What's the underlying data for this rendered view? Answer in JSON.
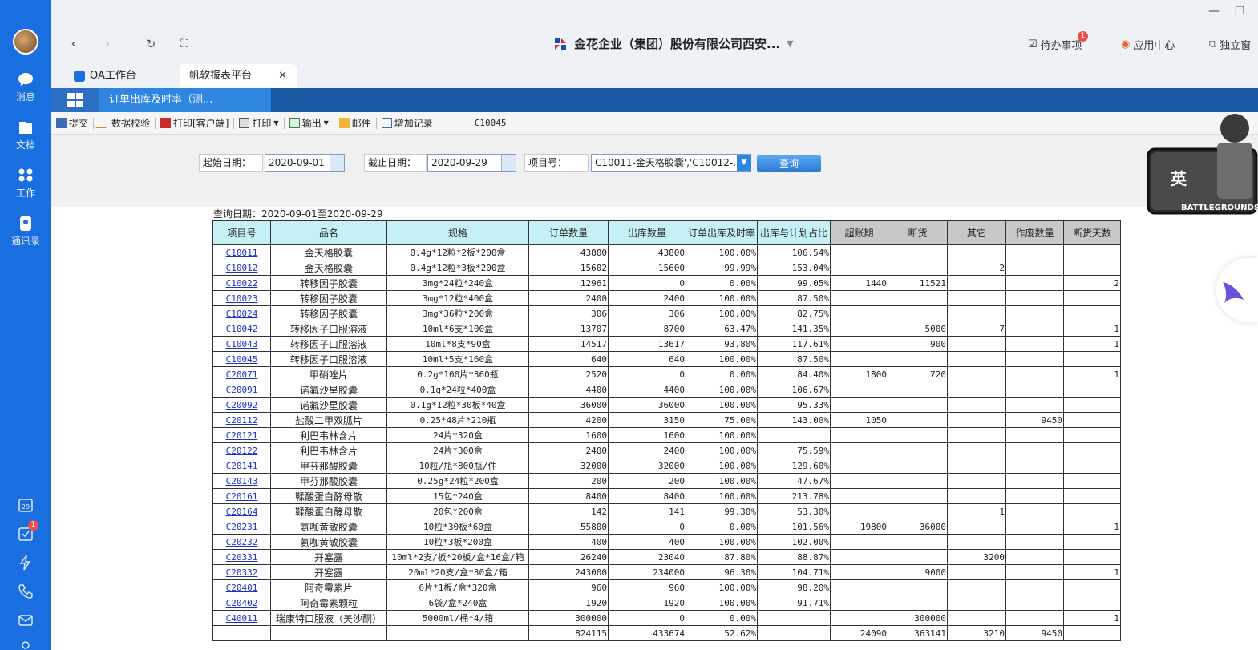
{
  "rail": {
    "items": [
      {
        "label": "消息",
        "icon": "chat-icon"
      },
      {
        "label": "文档",
        "icon": "document-icon"
      },
      {
        "label": "工作",
        "icon": "work-grid-icon"
      },
      {
        "label": "通讯录",
        "icon": "contacts-icon"
      }
    ],
    "calendar_day": "29",
    "todo_badge": "1"
  },
  "browser": {
    "title": "金花企业（集团）股份有限公司西安...",
    "todo_label": "待办事项",
    "todo_badge": "1",
    "app_center_label": "应用中心",
    "standalone_label": "独立窗"
  },
  "tabs": [
    {
      "label": "OA工作台"
    },
    {
      "label": "帆软报表平台"
    }
  ],
  "report_tab": "订单出库及时率（测...",
  "toolbar": {
    "submit": "提交",
    "validate": "数据校验",
    "print_client": "打印[客户端]",
    "print": "打印",
    "export": "输出",
    "mail": "邮件",
    "add_record": "增加记录",
    "code": "C10045"
  },
  "form": {
    "start_label": "起始日期：",
    "start_value": "2020-09-01",
    "end_label": "截止日期：",
    "end_value": "2020-09-29",
    "project_label": "项目号：",
    "project_value": "C10011-金天格胶囊','C10012-...",
    "query_button": "查询"
  },
  "report": {
    "query_date": "查询日期：2020-09-01至2020-09-29",
    "headers": [
      "项目号",
      "品名",
      "规格",
      "订单数量",
      "出库数量",
      "订单出库及时率",
      "出库与计划占比",
      "超账期",
      "断货",
      "其它",
      "作废数量",
      "断货天数"
    ],
    "rows": [
      [
        "C10011",
        "金天格胶囊",
        "0.4g*12粒*2板*200盒",
        "43800",
        "43800",
        "100.00%",
        "106.54%",
        "",
        "",
        "",
        "",
        ""
      ],
      [
        "C10012",
        "金天格胶囊",
        "0.4g*12粒*3板*200盒",
        "15602",
        "15600",
        "99.99%",
        "153.04%",
        "",
        "",
        "2",
        "",
        ""
      ],
      [
        "C10022",
        "转移因子胶囊",
        "3mg*24粒*240盒",
        "12961",
        "0",
        "0.00%",
        "99.05%",
        "1440",
        "11521",
        "",
        "",
        "2"
      ],
      [
        "C10023",
        "转移因子胶囊",
        "3mg*12粒*400盒",
        "2400",
        "2400",
        "100.00%",
        "87.50%",
        "",
        "",
        "",
        "",
        ""
      ],
      [
        "C10024",
        "转移因子胶囊",
        "3mg*36粒*200盒",
        "306",
        "306",
        "100.00%",
        "82.75%",
        "",
        "",
        "",
        "",
        ""
      ],
      [
        "C10042",
        "转移因子口服溶液",
        "10ml*6支*100盒",
        "13707",
        "8700",
        "63.47%",
        "141.35%",
        "",
        "5000",
        "7",
        "",
        "1"
      ],
      [
        "C10043",
        "转移因子口服溶液",
        "10ml*8支*90盒",
        "14517",
        "13617",
        "93.80%",
        "117.61%",
        "",
        "900",
        "",
        "",
        "1"
      ],
      [
        "C10045",
        "转移因子口服溶液",
        "10ml*5支*160盒",
        "640",
        "640",
        "100.00%",
        "87.50%",
        "",
        "",
        "",
        "",
        ""
      ],
      [
        "C20071",
        "甲硝唑片",
        "0.2g*100片*360瓶",
        "2520",
        "0",
        "0.00%",
        "84.40%",
        "1800",
        "720",
        "",
        "",
        "1"
      ],
      [
        "C20091",
        "诺氟沙星胶囊",
        "0.1g*24粒*400盒",
        "4400",
        "4400",
        "100.00%",
        "106.67%",
        "",
        "",
        "",
        "",
        ""
      ],
      [
        "C20092",
        "诺氟沙星胶囊",
        "0.1g*12粒*30板*40盒",
        "36000",
        "36000",
        "100.00%",
        "95.33%",
        "",
        "",
        "",
        "",
        ""
      ],
      [
        "C20112",
        "盐酸二甲双胍片",
        "0.25*48片*210瓶",
        "4200",
        "3150",
        "75.00%",
        "143.00%",
        "1050",
        "",
        "",
        "9450",
        ""
      ],
      [
        "C20121",
        "利巴韦林含片",
        "24片*320盒",
        "1600",
        "1600",
        "100.00%",
        "",
        "",
        "",
        "",
        "",
        ""
      ],
      [
        "C20122",
        "利巴韦林含片",
        "24片*300盒",
        "2400",
        "2400",
        "100.00%",
        "75.59%",
        "",
        "",
        "",
        "",
        ""
      ],
      [
        "C20141",
        "甲芬那酸胶囊",
        "10粒/瓶*800瓶/件",
        "32000",
        "32000",
        "100.00%",
        "129.60%",
        "",
        "",
        "",
        "",
        ""
      ],
      [
        "C20143",
        "甲芬那酸胶囊",
        "0.25g*24粒*200盒",
        "200",
        "200",
        "100.00%",
        "47.67%",
        "",
        "",
        "",
        "",
        ""
      ],
      [
        "C20161",
        "鞣酸蛋白酵母散",
        "15包*240盒",
        "8400",
        "8400",
        "100.00%",
        "213.78%",
        "",
        "",
        "",
        "",
        ""
      ],
      [
        "C20164",
        "鞣酸蛋白酵母散",
        "20包*200盒",
        "142",
        "141",
        "99.30%",
        "53.30%",
        "",
        "",
        "1",
        "",
        ""
      ],
      [
        "C20231",
        "氨咖黄敏胶囊",
        "10粒*30板*60盒",
        "55800",
        "0",
        "0.00%",
        "101.56%",
        "19800",
        "36000",
        "",
        "",
        "1"
      ],
      [
        "C20232",
        "氨咖黄敏胶囊",
        "10粒*3板*200盒",
        "400",
        "400",
        "100.00%",
        "102.00%",
        "",
        "",
        "",
        "",
        ""
      ],
      [
        "C20331",
        "开塞露",
        "10ml*2支/板*20板/盒*16盒/箱",
        "26240",
        "23040",
        "87.80%",
        "88.87%",
        "",
        "",
        "3200",
        "",
        ""
      ],
      [
        "C20332",
        "开塞露",
        "20ml*20支/盒*30盒/箱",
        "243000",
        "234000",
        "96.30%",
        "104.71%",
        "",
        "9000",
        "",
        "",
        "1"
      ],
      [
        "C20401",
        "阿奇霉素片",
        "6片*1板/盒*320盒",
        "960",
        "960",
        "100.00%",
        "98.20%",
        "",
        "",
        "",
        "",
        ""
      ],
      [
        "C20402",
        "阿奇霉素颗粒",
        "6袋/盒*240盒",
        "1920",
        "1920",
        "100.00%",
        "91.71%",
        "",
        "",
        "",
        "",
        ""
      ],
      [
        "C40011",
        "瑞康特口服液（美沙酮）",
        "5000ml/桶*4/箱",
        "300000",
        "0",
        "0.00%",
        "",
        "",
        "300000",
        "",
        "",
        "1"
      ]
    ],
    "totals": [
      "",
      "",
      "",
      "824115",
      "433674",
      "52.62%",
      "",
      "24090",
      "363141",
      "3210",
      "9450",
      ""
    ]
  },
  "overlay": {
    "badge_text": "BATTLEGROUNDS",
    "badge_char": "英"
  }
}
